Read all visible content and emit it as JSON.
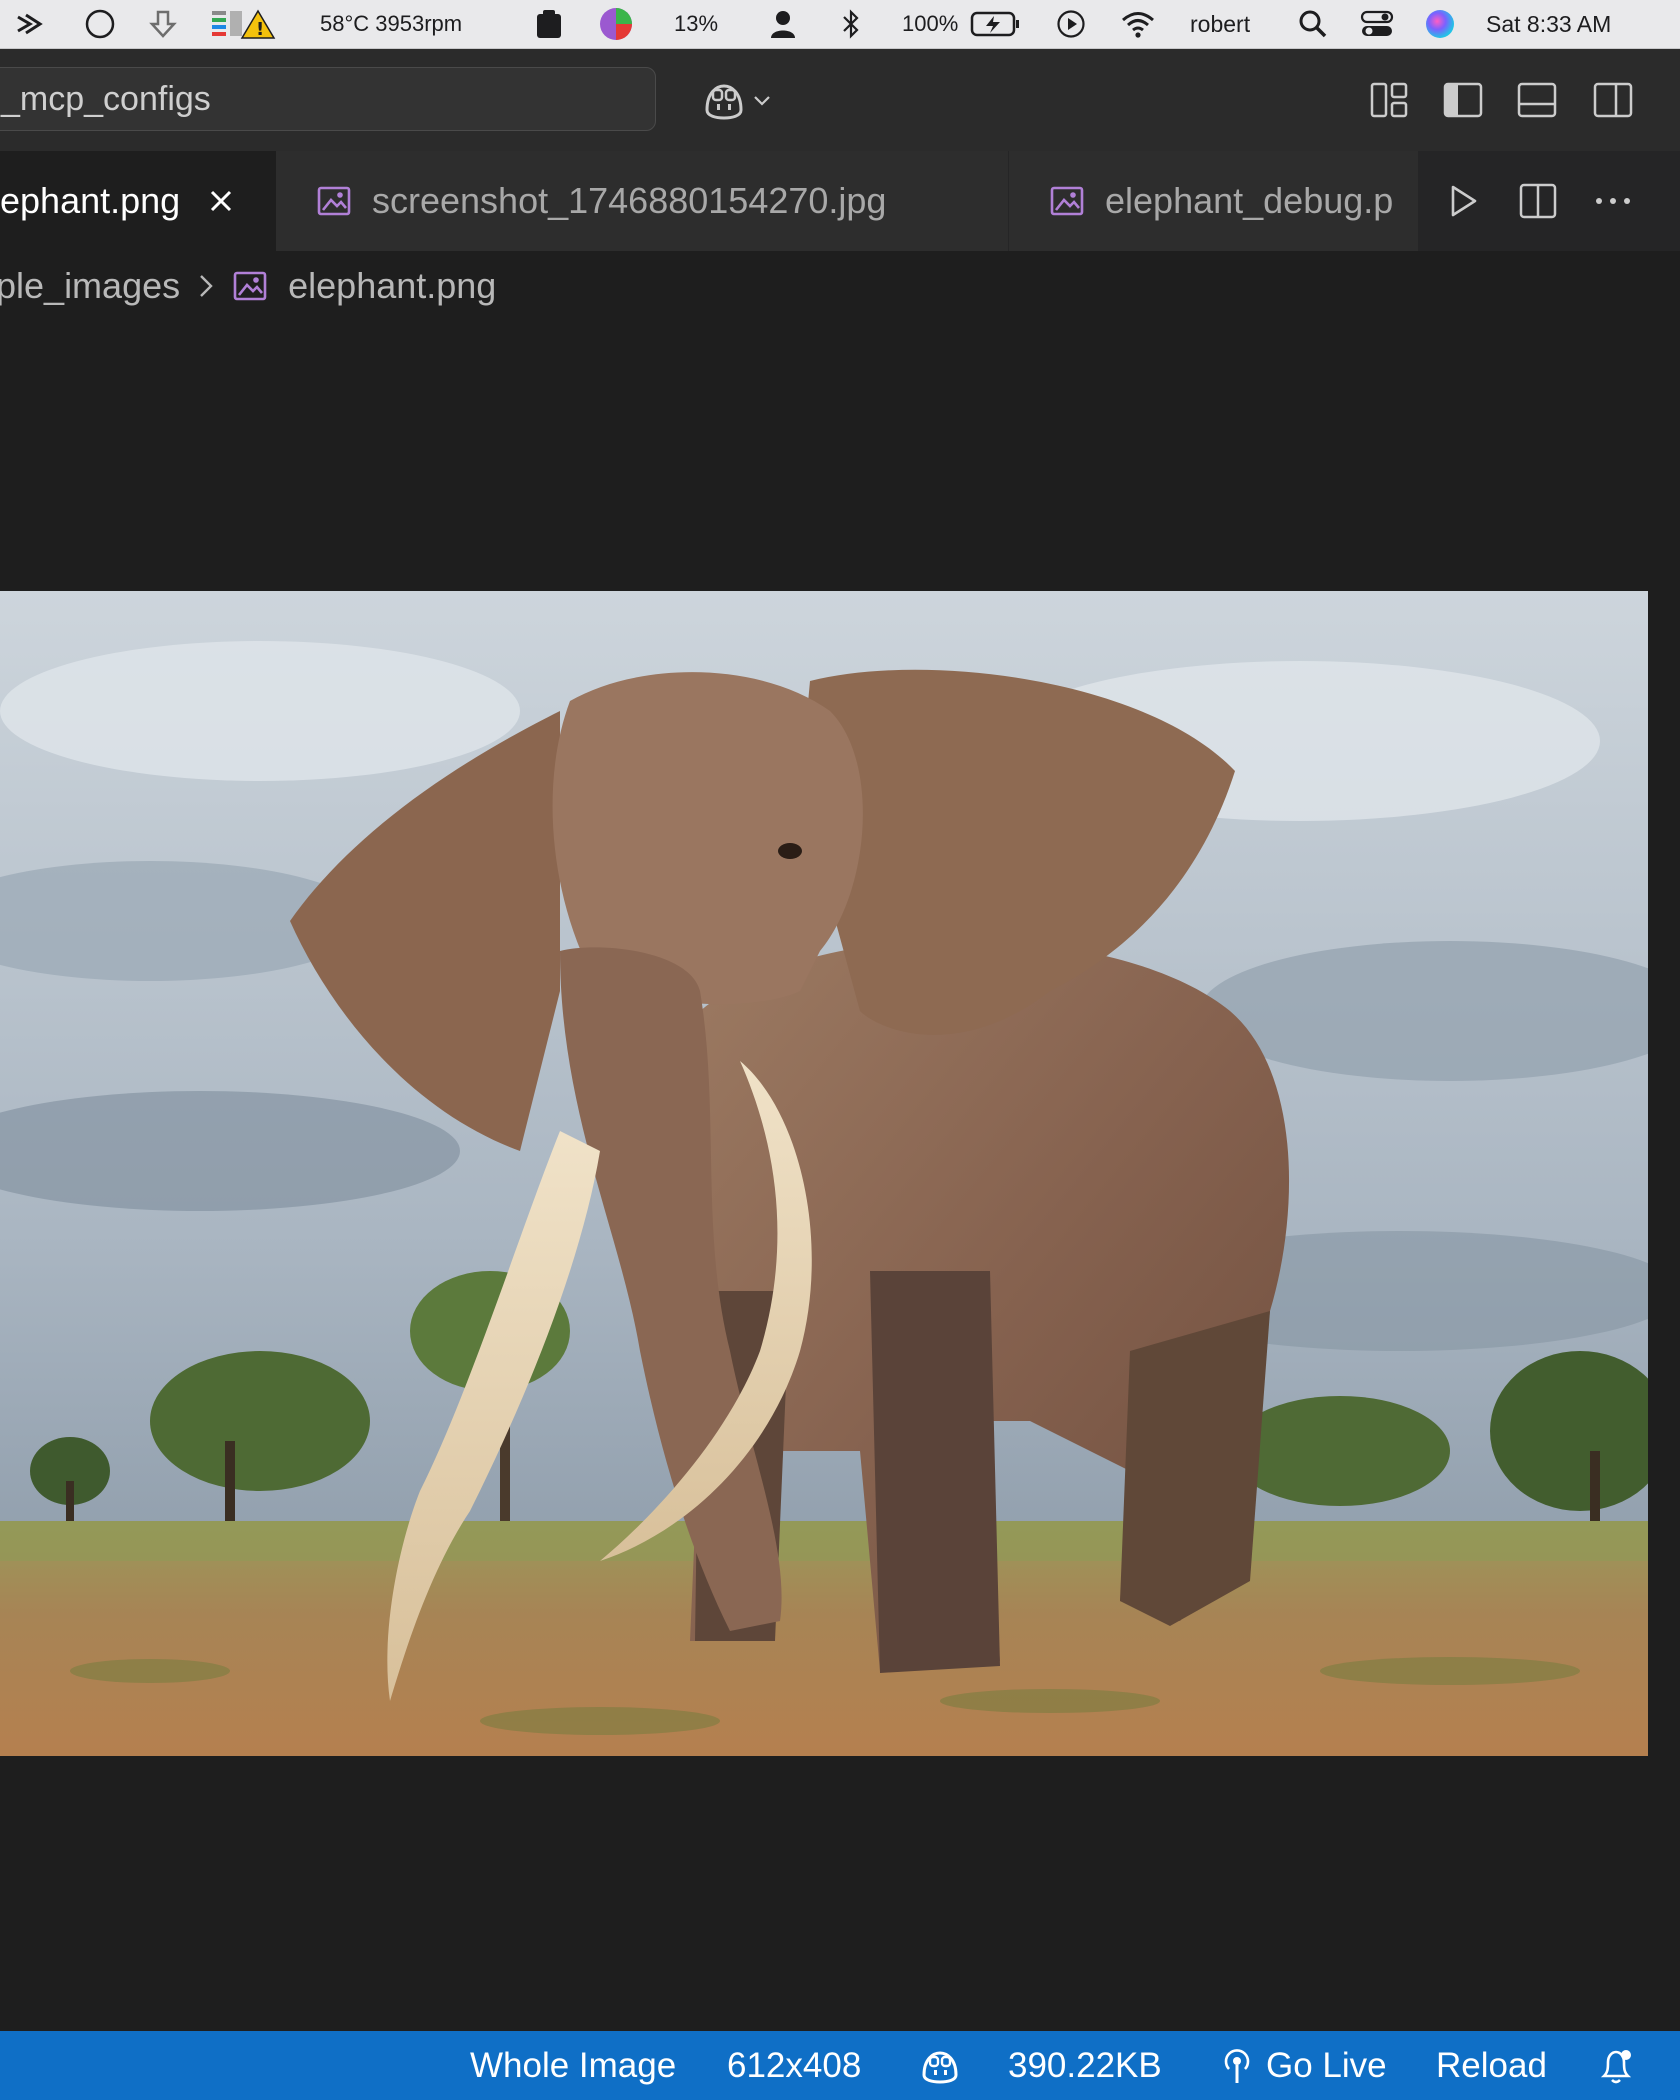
{
  "menubar": {
    "sensors": "58°C 3953rpm",
    "cpu_percent": "13%",
    "battery_percent": "100%",
    "username": "robert",
    "clock": "Sat  8:33 AM"
  },
  "titlebar": {
    "search_text": "_mcp_configs"
  },
  "tabs": [
    {
      "label": "ephant.png",
      "active": true
    },
    {
      "label": "screenshot_1746880154270.jpg",
      "active": false
    },
    {
      "label": "elephant_debug.p",
      "active": false
    }
  ],
  "breadcrumb": {
    "folder": "ple_images",
    "file": "elephant.png"
  },
  "statusbar": {
    "zoom": "Whole Image",
    "dimensions": "612x408",
    "file_size": "390.22KB",
    "go_live": "Go Live",
    "reload": "Reload"
  },
  "colors": {
    "statusbar_bg": "#0f6fc6",
    "image_icon": "#b180d7",
    "editor_bg": "#1e1e1e"
  },
  "icons": [
    "copilot-icon",
    "layout-icon",
    "toggle-sidebar-icon",
    "toggle-panel-icon",
    "toggle-secondary-sidebar-icon",
    "image-file-icon",
    "close-icon",
    "run-icon",
    "split-editor-icon",
    "more-actions-icon",
    "broadcast-icon",
    "bell-icon"
  ]
}
